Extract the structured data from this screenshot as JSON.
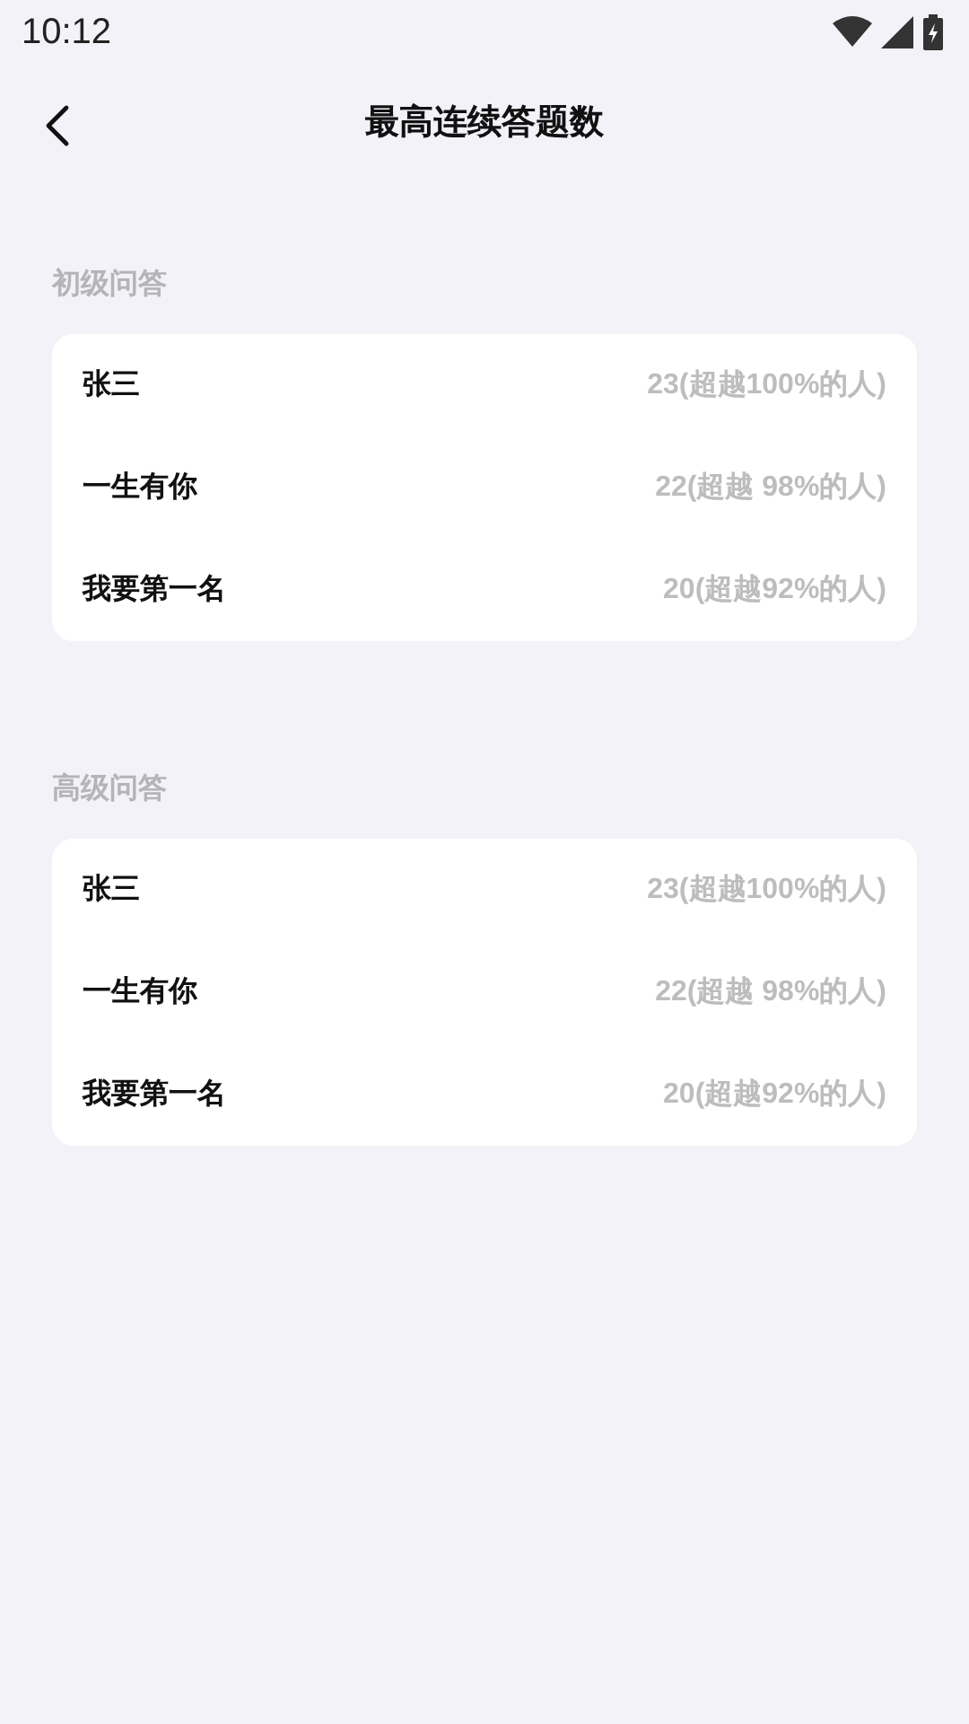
{
  "status_bar": {
    "time": "10:12"
  },
  "header": {
    "title": "最高连续答题数"
  },
  "sections": [
    {
      "title": "初级问答",
      "rows": [
        {
          "name": "张三",
          "value": "23(超越100%的人)"
        },
        {
          "name": "一生有你",
          "value": "22(超越 98%的人)"
        },
        {
          "name": "我要第一名",
          "value": "20(超越92%的人)"
        }
      ]
    },
    {
      "title": "高级问答",
      "rows": [
        {
          "name": "张三",
          "value": "23(超越100%的人)"
        },
        {
          "name": "一生有你",
          "value": "22(超越 98%的人)"
        },
        {
          "name": "我要第一名",
          "value": "20(超越92%的人)"
        }
      ]
    }
  ]
}
